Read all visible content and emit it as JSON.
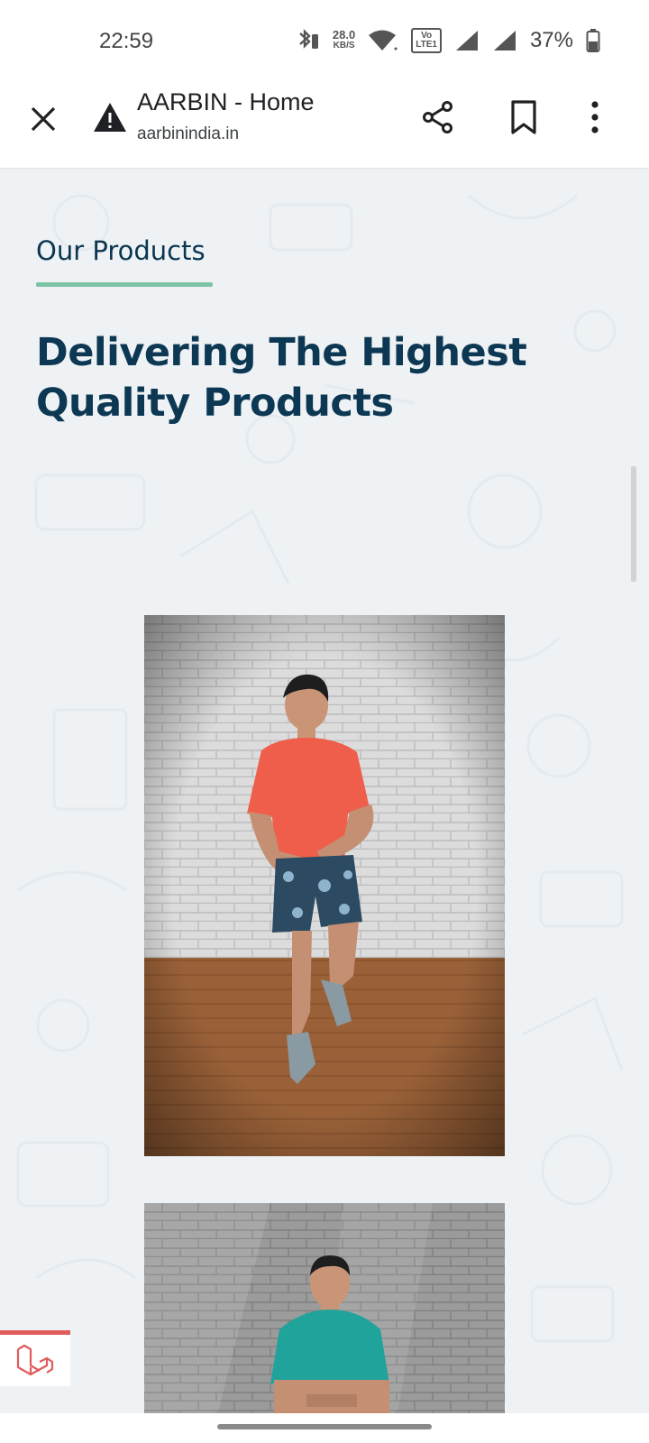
{
  "status_bar": {
    "time": "22:59",
    "speed_value": "28.0",
    "speed_unit": "KB/S",
    "volte_top": "Vo",
    "volte_bottom": "LTE1",
    "battery": "37%"
  },
  "browser": {
    "title": "AARBIN - Home",
    "url": "aarbinindia.in"
  },
  "page": {
    "section_label": "Our Products",
    "heading_line1": "Delivering The Highest",
    "heading_line2": "Quality Products"
  },
  "products": [
    {
      "name": "product-orange-tee-printed-shorts",
      "tee_color": "#ef5e4a",
      "shorts_color": "#2d4a63"
    },
    {
      "name": "product-teal-tee",
      "tee_color": "#1fa39b"
    }
  ],
  "colors": {
    "accent_underline": "#7cc2a4",
    "heading": "#0d3853",
    "background": "#eef2f5",
    "laravel_red": "#e05c5c"
  }
}
